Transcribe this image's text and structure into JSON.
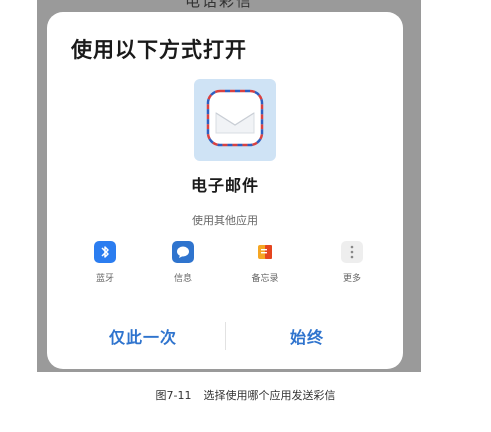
{
  "background_title": "电话彩信",
  "dialog": {
    "title": "使用以下方式打开",
    "primary_app": {
      "name": "电子邮件",
      "icon": "envelope-icon"
    },
    "other_apps_label": "使用其他应用",
    "apps": [
      {
        "label": "蓝牙",
        "icon": "bluetooth-icon",
        "color": "#2b7df0"
      },
      {
        "label": "信息",
        "icon": "message-icon",
        "color": "#2f74ce"
      },
      {
        "label": "备忘录",
        "icon": "memo-icon",
        "color": "#f5a623"
      },
      {
        "label": "更多",
        "icon": "more-icon",
        "color": "#cccccc"
      }
    ],
    "buttons": {
      "once": "仅此一次",
      "always": "始终"
    }
  },
  "caption": {
    "figure_number": "图7-11",
    "text": "选择使用哪个应用发送彩信"
  },
  "colors": {
    "accent": "#2f74ce",
    "tile_bg": "#cfe3f5",
    "backdrop": "#9a9a9a"
  }
}
